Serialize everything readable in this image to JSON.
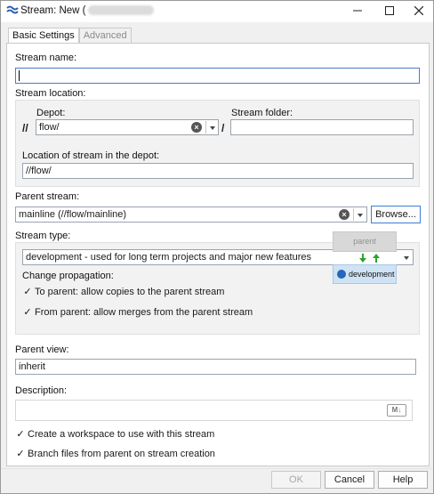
{
  "window": {
    "title": "Stream: New (",
    "controls": {
      "minimize": "—",
      "maximize": "☐",
      "close": "✕"
    }
  },
  "tabs": [
    {
      "label": "Basic Settings",
      "active": true
    },
    {
      "label": "Advanced",
      "active": false
    }
  ],
  "form": {
    "stream_name": {
      "label": "Stream name:",
      "value": ""
    },
    "stream_location": {
      "label": "Stream location:"
    },
    "depot": {
      "label": "Depot:",
      "value": "flow/",
      "prefix": "//"
    },
    "stream_folder": {
      "label": "Stream folder:",
      "value": "",
      "prefix": "/"
    },
    "location_in_depot": {
      "label": "Location of stream in the depot:",
      "value": "//flow/"
    },
    "parent_stream": {
      "label": "Parent stream:",
      "value": "mainline (//flow/mainline)",
      "browse_label": "Browse..."
    },
    "stream_type": {
      "label": "Stream type:",
      "value": "development - used for long term projects and major new features"
    },
    "change_propagation": {
      "label": "Change propagation:",
      "to_parent": {
        "label": "To parent: allow copies to the parent stream",
        "checked": true
      },
      "from_parent": {
        "label": "From parent: allow merges from the parent stream",
        "checked": true
      }
    },
    "diagram": {
      "parent_label": "parent",
      "child_label": "development"
    },
    "parent_view": {
      "label": "Parent view:",
      "value": "inherit"
    },
    "description": {
      "label": "Description:",
      "value": "",
      "markdown_badge": "M↓"
    },
    "create_workspace": {
      "label": "Create a workspace to use with this stream",
      "checked": true
    },
    "branch_files": {
      "label": "Branch files from parent on stream creation",
      "checked": true
    }
  },
  "buttons": {
    "ok": "OK",
    "cancel": "Cancel",
    "help": "Help"
  },
  "colors": {
    "accent": "#3c7fd4",
    "dev_badge": "#cfe3f5",
    "arrow_green": "#2aa52a"
  }
}
